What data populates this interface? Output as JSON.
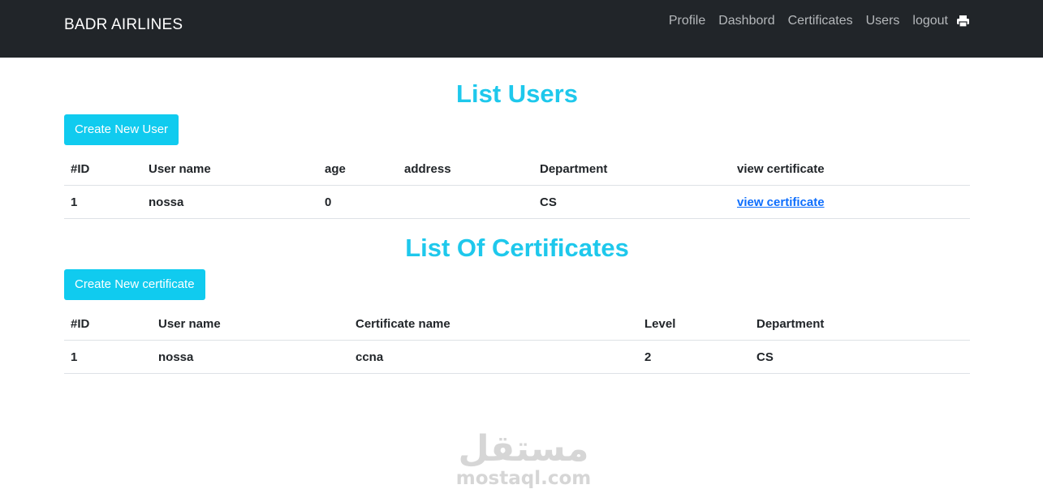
{
  "navbar": {
    "brand": "BADR AIRLINES",
    "links": [
      "Profile",
      "Dashbord",
      "Certificates",
      "Users",
      "logout"
    ],
    "logout_icon": "print-icon"
  },
  "users_section": {
    "title": "List Users",
    "create_button": "Create New User",
    "columns": [
      "#ID",
      "User name",
      "age",
      "address",
      "Department",
      "view certificate"
    ],
    "rows": [
      {
        "id": "1",
        "user_name": "nossa",
        "age": "0",
        "address": "",
        "department": "CS",
        "view_certificate": "view certificate"
      }
    ]
  },
  "certificates_section": {
    "title": "List Of Certificates",
    "create_button": "Create New certificate",
    "columns": [
      "#ID",
      "User name",
      "Certificate name",
      "Level",
      "Department"
    ],
    "rows": [
      {
        "id": "1",
        "user_name": "nossa",
        "certificate_name": "ccna",
        "level": "2",
        "department": "CS"
      }
    ]
  },
  "watermark": {
    "arabic": "مستقل",
    "latin": "mostaql.com"
  },
  "colors": {
    "navbar_bg": "#212529",
    "accent": "#10cbef",
    "title": "#1ec8ec",
    "link": "#0d6efd"
  }
}
